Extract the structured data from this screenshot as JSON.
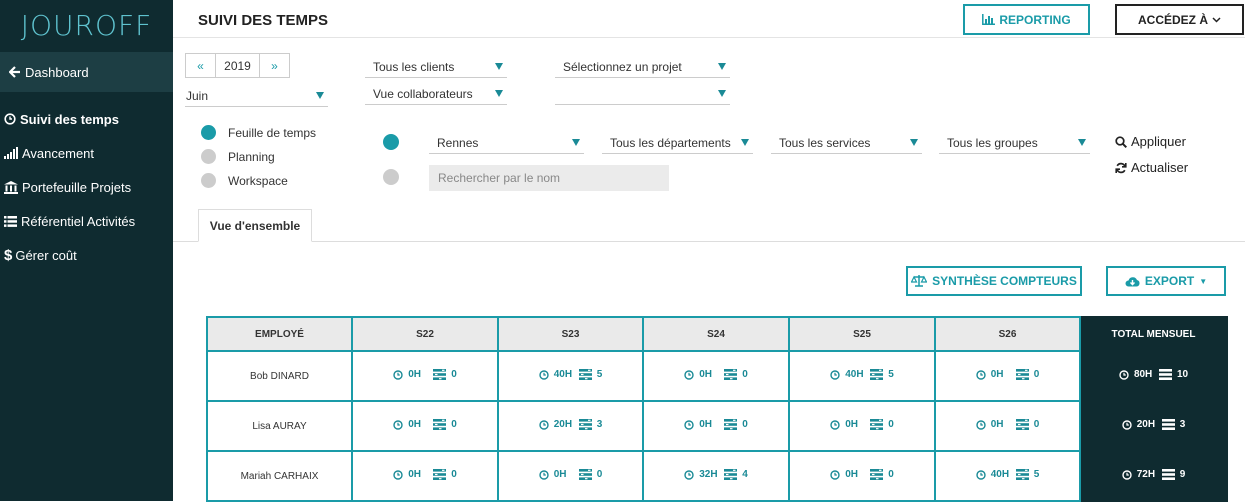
{
  "app": {
    "logo": "JOUROFF"
  },
  "sidebar": {
    "dashboard": "Dashboard",
    "items": [
      {
        "label": "Suivi des temps",
        "icon": "clock-icon"
      },
      {
        "label": "Avancement",
        "icon": "signal-bars-icon"
      },
      {
        "label": "Portefeuille Projets",
        "icon": "bank-icon"
      },
      {
        "label": "Référentiel Activités",
        "icon": "list-icon"
      },
      {
        "label": "Gérer coût",
        "icon": "dollar-icon"
      }
    ]
  },
  "header": {
    "title": "SUIVI DES TEMPS",
    "reporting": "REPORTING",
    "access": "ACCÉDEZ À"
  },
  "filters": {
    "year": "2019",
    "month": "Juin",
    "clients": "Tous les clients",
    "project": "Sélectionnez un projet",
    "view": "Vue collaborateurs",
    "empty": "",
    "mode_options": [
      "Feuille de temps",
      "Planning",
      "Workspace"
    ],
    "location": "Rennes",
    "departments": "Tous les départements",
    "services": "Tous les services",
    "groups": "Tous les groupes",
    "search_placeholder": "Rechercher par le nom",
    "apply": "Appliquer",
    "refresh": "Actualiser"
  },
  "tabs": {
    "overview": "Vue d'ensemble"
  },
  "toolbar": {
    "synthese": "SYNTHÈSE COMPTEURS",
    "export": "EXPORT"
  },
  "colors": {
    "accent": "#1a9ba8",
    "sidebar": "#0f2b30"
  },
  "table": {
    "headers": [
      "EMPLOYÉ",
      "S22",
      "S23",
      "S24",
      "S25",
      "S26",
      "TOTAL MENSUEL"
    ],
    "rows": [
      {
        "name": "Bob DINARD",
        "weeks": [
          [
            "0H",
            "0"
          ],
          [
            "40H",
            "5"
          ],
          [
            "0H",
            "0"
          ],
          [
            "40H",
            "5"
          ],
          [
            "0H",
            "0"
          ]
        ],
        "total": [
          "80H",
          "10"
        ]
      },
      {
        "name": "Lisa AURAY",
        "weeks": [
          [
            "0H",
            "0"
          ],
          [
            "20H",
            "3"
          ],
          [
            "0H",
            "0"
          ],
          [
            "0H",
            "0"
          ],
          [
            "0H",
            "0"
          ]
        ],
        "total": [
          "20H",
          "3"
        ]
      },
      {
        "name": "Mariah CARHAIX",
        "weeks": [
          [
            "0H",
            "0"
          ],
          [
            "0H",
            "0"
          ],
          [
            "32H",
            "4"
          ],
          [
            "0H",
            "0"
          ],
          [
            "40H",
            "5"
          ]
        ],
        "total": [
          "72H",
          "9"
        ]
      }
    ]
  }
}
